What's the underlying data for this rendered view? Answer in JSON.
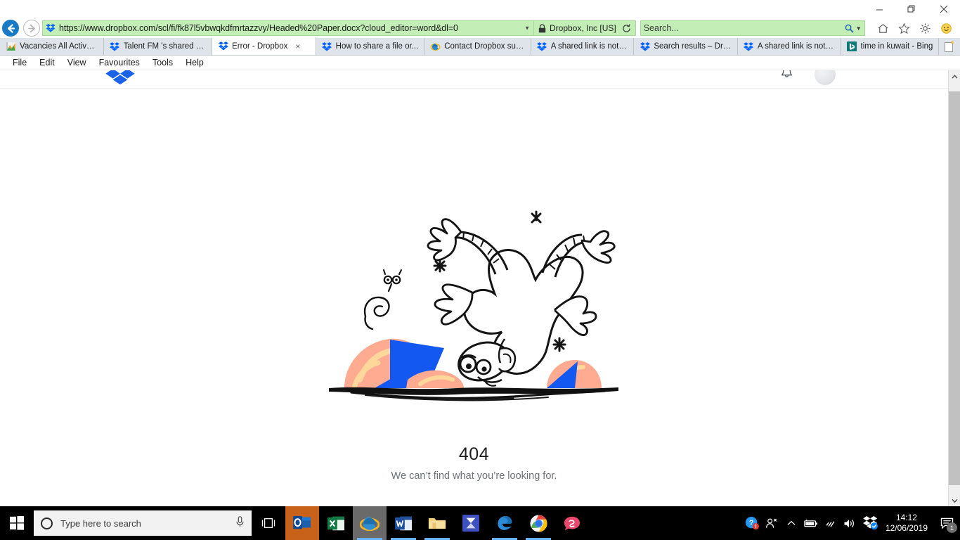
{
  "window": {
    "minimize_label": "Minimize",
    "restore_label": "Restore",
    "close_label": "Close"
  },
  "browser": {
    "back_label": "Back",
    "forward_label": "Forward",
    "url_scheme": "https://",
    "url_host": "www.dropbox.com",
    "url_path": "/scl/fi/fk87l5vbwqkdfmrtazzvy/Headed%20Paper.docx?cloud_editor=word&dl=0",
    "url_full": "https://www.dropbox.com/scl/fi/fk87l5vbwqkdfmrtazzvy/Headed%20Paper.docx?cloud_editor=word&dl=0",
    "security_label": "Dropbox, Inc [US]",
    "refresh_label": "Refresh",
    "search_placeholder": "Search...",
    "icons": {
      "home": "home-icon",
      "favorites": "star-icon",
      "settings": "gear-icon",
      "feedback": "smiley-icon"
    }
  },
  "tabs": [
    {
      "label": "Vacancies All Active ...",
      "favicon": "chart-icon",
      "active": false
    },
    {
      "label": "Talent FM 's shared w...",
      "favicon": "dropbox-icon",
      "active": false
    },
    {
      "label": "Error - Dropbox",
      "favicon": "dropbox-icon",
      "active": true,
      "close_label": "×"
    },
    {
      "label": "How to share a file or...",
      "favicon": "dropbox-icon",
      "active": false
    },
    {
      "label": "Contact Dropbox sup...",
      "favicon": "ie-icon",
      "active": false
    },
    {
      "label": "A shared link is not w...",
      "favicon": "dropbox-icon",
      "active": false
    },
    {
      "label": "Search results – Drop...",
      "favicon": "dropbox-icon",
      "active": false
    },
    {
      "label": "A shared link is not w...",
      "favicon": "dropbox-icon",
      "active": false
    },
    {
      "label": "time in kuwait - Bing",
      "favicon": "bing-icon",
      "active": false
    }
  ],
  "newtab_label": "New tab",
  "menu": [
    {
      "label": "File"
    },
    {
      "label": "Edit"
    },
    {
      "label": "View"
    },
    {
      "label": "Favourites"
    },
    {
      "label": "Tools"
    },
    {
      "label": "Help"
    }
  ],
  "page": {
    "logo_name": "dropbox-logo",
    "notifications_label": "Notifications",
    "avatar_label": "Account",
    "error_code": "404",
    "error_message": "We can’t find what you’re looking for.",
    "illustration_name": "falling-character-illustration"
  },
  "colors": {
    "dropbox_blue": "#0061ff",
    "illustration_blue": "#1358f0",
    "illustration_orange": "#ffab91",
    "illustration_orange_light": "#ffd79b",
    "url_bar_green": "#c3efb6",
    "error_text": "#6b7278"
  },
  "scrollbar": {
    "up_label": "Scroll up",
    "down_label": "Scroll down"
  },
  "taskbar": {
    "start_label": "Start",
    "search_placeholder": "Type here to search",
    "mic_label": "Cortana microphone",
    "taskview_label": "Task View",
    "apps": [
      {
        "name": "outlook",
        "label": "Outlook"
      },
      {
        "name": "excel",
        "label": "Excel"
      },
      {
        "name": "internet-explorer",
        "label": "Internet Explorer"
      },
      {
        "name": "word",
        "label": "Word"
      },
      {
        "name": "file-explorer",
        "label": "File Explorer"
      },
      {
        "name": "scanner",
        "label": "Scanner"
      },
      {
        "name": "edge",
        "label": "Microsoft Edge"
      },
      {
        "name": "chrome",
        "label": "Google Chrome"
      },
      {
        "name": "sage",
        "label": "Sage"
      }
    ],
    "tray": [
      {
        "name": "help-icon",
        "label": "Help"
      },
      {
        "name": "people-icon",
        "label": "People"
      },
      {
        "name": "chevron-up-icon",
        "label": "Show hidden icons"
      },
      {
        "name": "battery-icon",
        "label": "Battery"
      },
      {
        "name": "wifi-icon",
        "label": "Network"
      },
      {
        "name": "volume-icon",
        "label": "Volume"
      },
      {
        "name": "dropbox-tray-icon",
        "label": "Dropbox"
      }
    ],
    "time": "14:12",
    "date": "12/06/2019",
    "notifications_count": "1",
    "notifications_label": "Action Center"
  }
}
